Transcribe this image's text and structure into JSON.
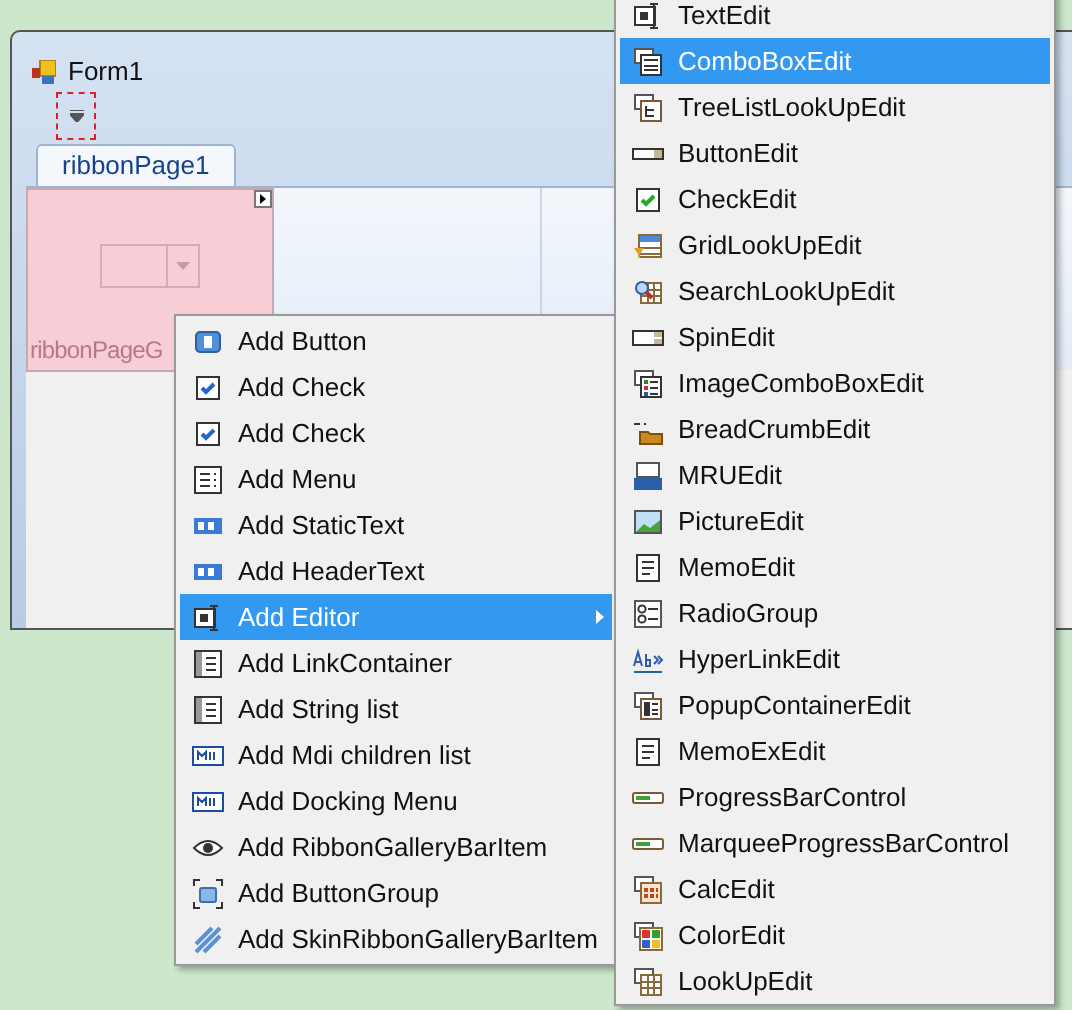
{
  "window": {
    "title": "Form1"
  },
  "tabs": [
    {
      "label": "ribbonPage1",
      "selected": true
    }
  ],
  "ribbon_group": {
    "label": "ribbonPageG"
  },
  "context_menu": {
    "items": [
      {
        "label": "Add Button",
        "selected": false,
        "submenu": false
      },
      {
        "label": "Add Check",
        "selected": false,
        "submenu": false
      },
      {
        "label": "Add Check",
        "selected": false,
        "submenu": false
      },
      {
        "label": "Add Menu",
        "selected": false,
        "submenu": false
      },
      {
        "label": "Add StaticText",
        "selected": false,
        "submenu": false
      },
      {
        "label": "Add HeaderText",
        "selected": false,
        "submenu": false
      },
      {
        "label": "Add Editor",
        "selected": true,
        "submenu": true
      },
      {
        "label": "Add LinkContainer",
        "selected": false,
        "submenu": false
      },
      {
        "label": "Add String list",
        "selected": false,
        "submenu": false
      },
      {
        "label": "Add Mdi children list",
        "selected": false,
        "submenu": false
      },
      {
        "label": "Add Docking Menu",
        "selected": false,
        "submenu": false
      },
      {
        "label": "Add RibbonGalleryBarItem",
        "selected": false,
        "submenu": false
      },
      {
        "label": "Add ButtonGroup",
        "selected": false,
        "submenu": false
      },
      {
        "label": "Add SkinRibbonGalleryBarItem",
        "selected": false,
        "submenu": false
      }
    ]
  },
  "submenu": {
    "items": [
      {
        "label": "TextEdit",
        "selected": false
      },
      {
        "label": "ComboBoxEdit",
        "selected": true
      },
      {
        "label": "TreeListLookUpEdit",
        "selected": false
      },
      {
        "label": "ButtonEdit",
        "selected": false
      },
      {
        "label": "CheckEdit",
        "selected": false
      },
      {
        "label": "GridLookUpEdit",
        "selected": false
      },
      {
        "label": "SearchLookUpEdit",
        "selected": false
      },
      {
        "label": "SpinEdit",
        "selected": false
      },
      {
        "label": "ImageComboBoxEdit",
        "selected": false
      },
      {
        "label": "BreadCrumbEdit",
        "selected": false
      },
      {
        "label": "MRUEdit",
        "selected": false
      },
      {
        "label": "PictureEdit",
        "selected": false
      },
      {
        "label": "MemoEdit",
        "selected": false
      },
      {
        "label": "RadioGroup",
        "selected": false
      },
      {
        "label": "HyperLinkEdit",
        "selected": false
      },
      {
        "label": "PopupContainerEdit",
        "selected": false
      },
      {
        "label": "MemoExEdit",
        "selected": false
      },
      {
        "label": "ProgressBarControl",
        "selected": false
      },
      {
        "label": "MarqueeProgressBarControl",
        "selected": false
      },
      {
        "label": "CalcEdit",
        "selected": false
      },
      {
        "label": "ColorEdit",
        "selected": false
      },
      {
        "label": "LookUpEdit",
        "selected": false
      }
    ]
  }
}
